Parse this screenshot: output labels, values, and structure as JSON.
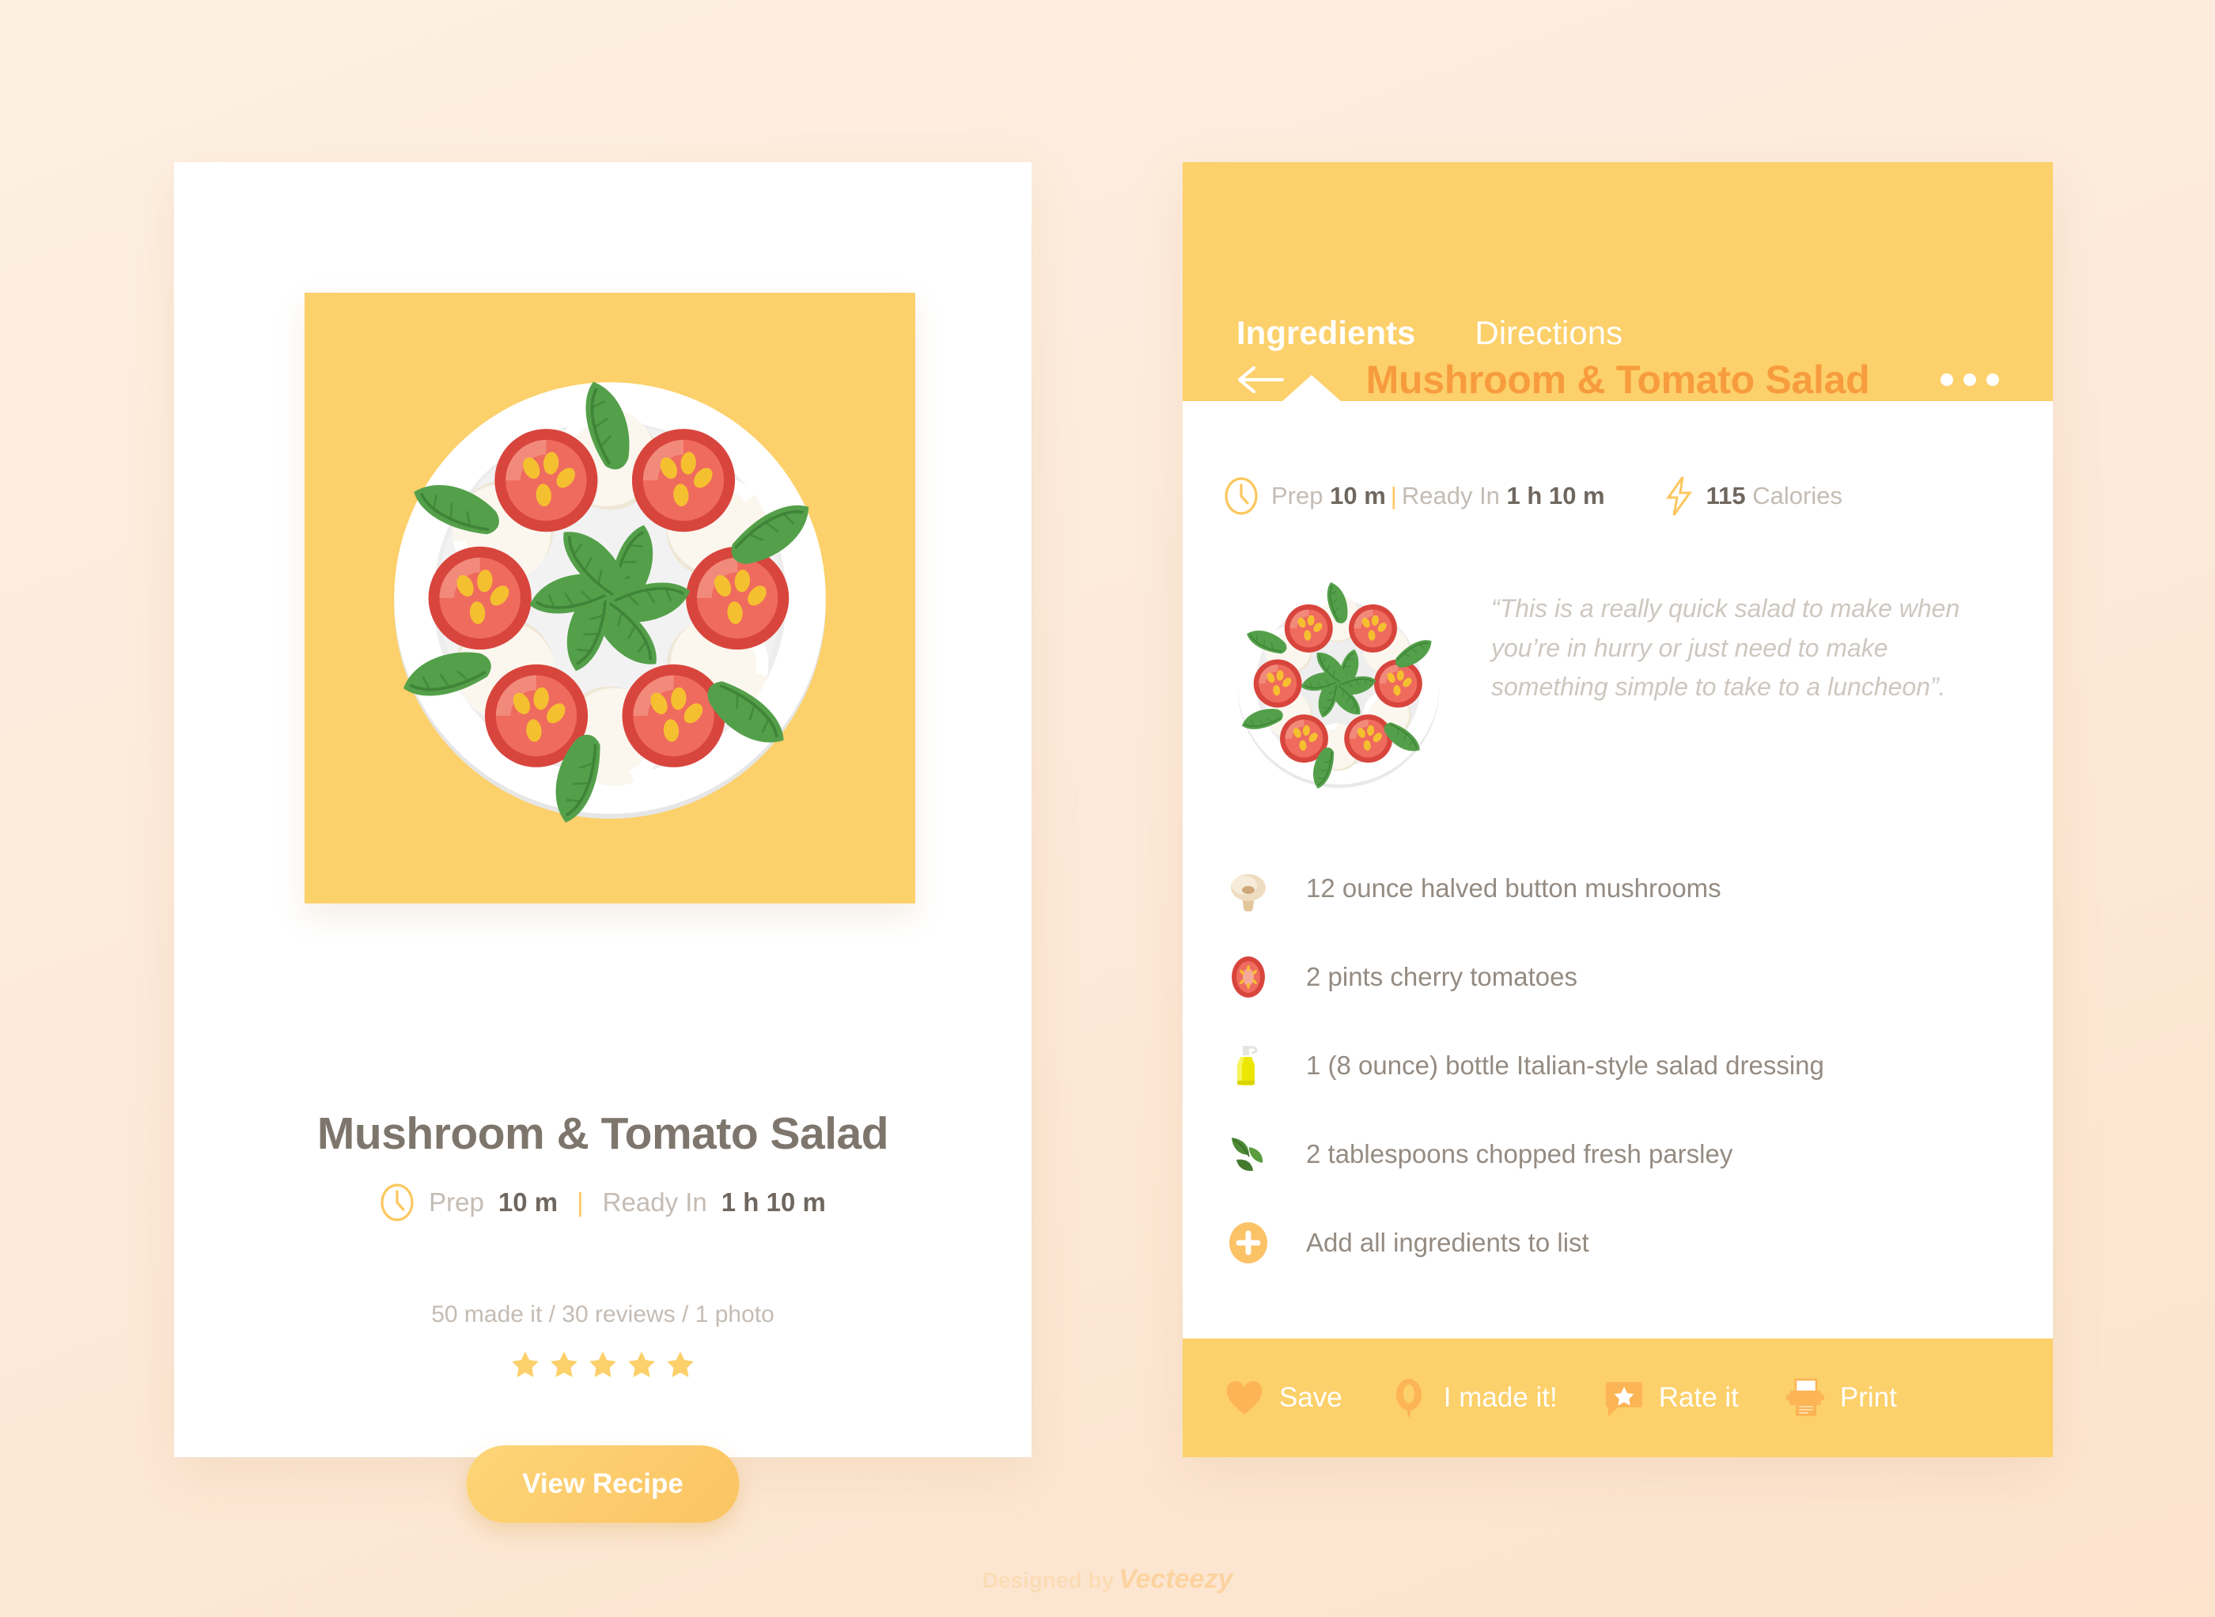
{
  "colors": {
    "page_bg": "#fdebd9",
    "accent_yellow": "#fcd06a",
    "accent_orange": "#f79c3e",
    "title_gray": "#7e766d",
    "body_gray": "#948b82",
    "muted_gray": "#c4bcb4"
  },
  "left_card": {
    "title": "Mushroom & Tomato Salad",
    "meta": {
      "clock_icon": "clock-icon",
      "prep_label": "Prep",
      "prep_value": "10 m",
      "separator": "|",
      "ready_label": "Ready In",
      "ready_value": "1 h 10 m"
    },
    "reviews_line": "50 made it / 30 reviews / 1 photo",
    "rating": 5,
    "rating_max": 5,
    "cta_label": "View Recipe",
    "hero_image_alt": "caprese-salad-illustration"
  },
  "right_panel": {
    "header": {
      "back_icon": "back-arrow-icon",
      "title": "Mushroom & Tomato Salad",
      "overflow_icon": "more-options-icon"
    },
    "tabs": [
      {
        "label": "Ingredients",
        "active": true
      },
      {
        "label": "Directions",
        "active": false
      }
    ],
    "info": {
      "clock_icon": "clock-icon",
      "prep_label": "Prep",
      "prep_value": "10 m",
      "separator": "|",
      "ready_label": "Ready In",
      "ready_value": "1 h 10 m",
      "bolt_icon": "lightning-bolt-icon",
      "calories_value": "115",
      "calories_label": "Calories"
    },
    "quote": "“This is a really quick salad to make when you’re in hurry or just need to make something simple to take to a luncheon”.",
    "thumbnail_alt": "caprese-salad-thumbnail",
    "ingredients": [
      {
        "icon": "mushroom-icon",
        "text": "12 ounce halved button mushrooms"
      },
      {
        "icon": "tomato-slice-icon",
        "text": "2 pints cherry tomatoes"
      },
      {
        "icon": "dressing-bottle-icon",
        "text": "1 (8 ounce) bottle Italian-style salad dressing"
      },
      {
        "icon": "parsley-icon",
        "text": "2 tablespoons chopped fresh parsley"
      },
      {
        "icon": "add-plus-icon",
        "text": "Add all ingredients to list"
      }
    ],
    "footer_actions": [
      {
        "icon": "heart-icon",
        "label": "Save"
      },
      {
        "icon": "spoon-icon",
        "label": "I made it!"
      },
      {
        "icon": "star-bubble-icon",
        "label": "Rate it"
      },
      {
        "icon": "printer-icon",
        "label": "Print"
      }
    ]
  },
  "credit": {
    "prefix": "Designed by",
    "brand": "Vecteezy"
  }
}
